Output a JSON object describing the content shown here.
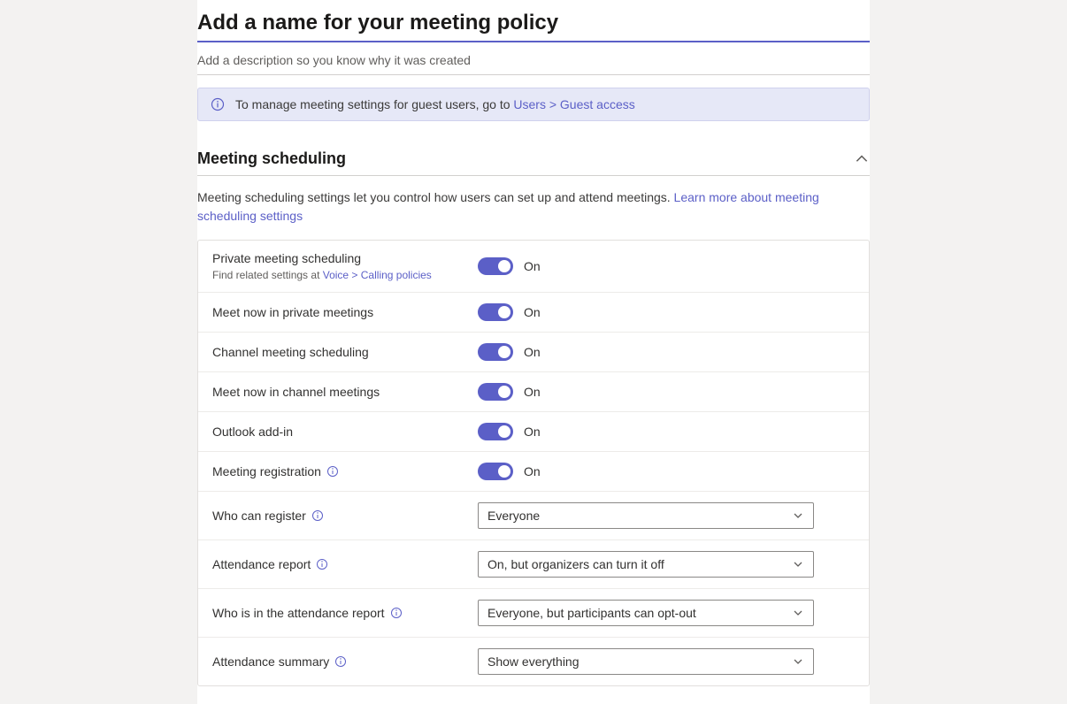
{
  "header": {
    "title_placeholder": "Add a name for your meeting policy",
    "desc_placeholder": "Add a description so you know why it was created"
  },
  "banner": {
    "text_prefix": "To manage meeting settings for guest users, go to ",
    "link_text": "Users > Guest access"
  },
  "section": {
    "title": "Meeting scheduling",
    "desc_prefix": "Meeting scheduling settings let you control how users can set up and attend meetings. ",
    "desc_link": "Learn more about meeting scheduling settings"
  },
  "settings": {
    "private_scheduling": {
      "label": "Private meeting scheduling",
      "sub_prefix": "Find related settings at ",
      "sub_link": "Voice > Calling policies",
      "state": "On"
    },
    "meet_now_private": {
      "label": "Meet now in private meetings",
      "state": "On"
    },
    "channel_scheduling": {
      "label": "Channel meeting scheduling",
      "state": "On"
    },
    "meet_now_channel": {
      "label": "Meet now in channel meetings",
      "state": "On"
    },
    "outlook_addin": {
      "label": "Outlook add-in",
      "state": "On"
    },
    "meeting_registration": {
      "label": "Meeting registration",
      "state": "On"
    },
    "who_can_register": {
      "label": "Who can register",
      "value": "Everyone"
    },
    "attendance_report": {
      "label": "Attendance report",
      "value": "On, but organizers can turn it off"
    },
    "who_in_report": {
      "label": "Who is in the attendance report",
      "value": "Everyone, but participants can opt-out"
    },
    "attendance_summary": {
      "label": "Attendance summary",
      "value": "Show everything"
    }
  }
}
